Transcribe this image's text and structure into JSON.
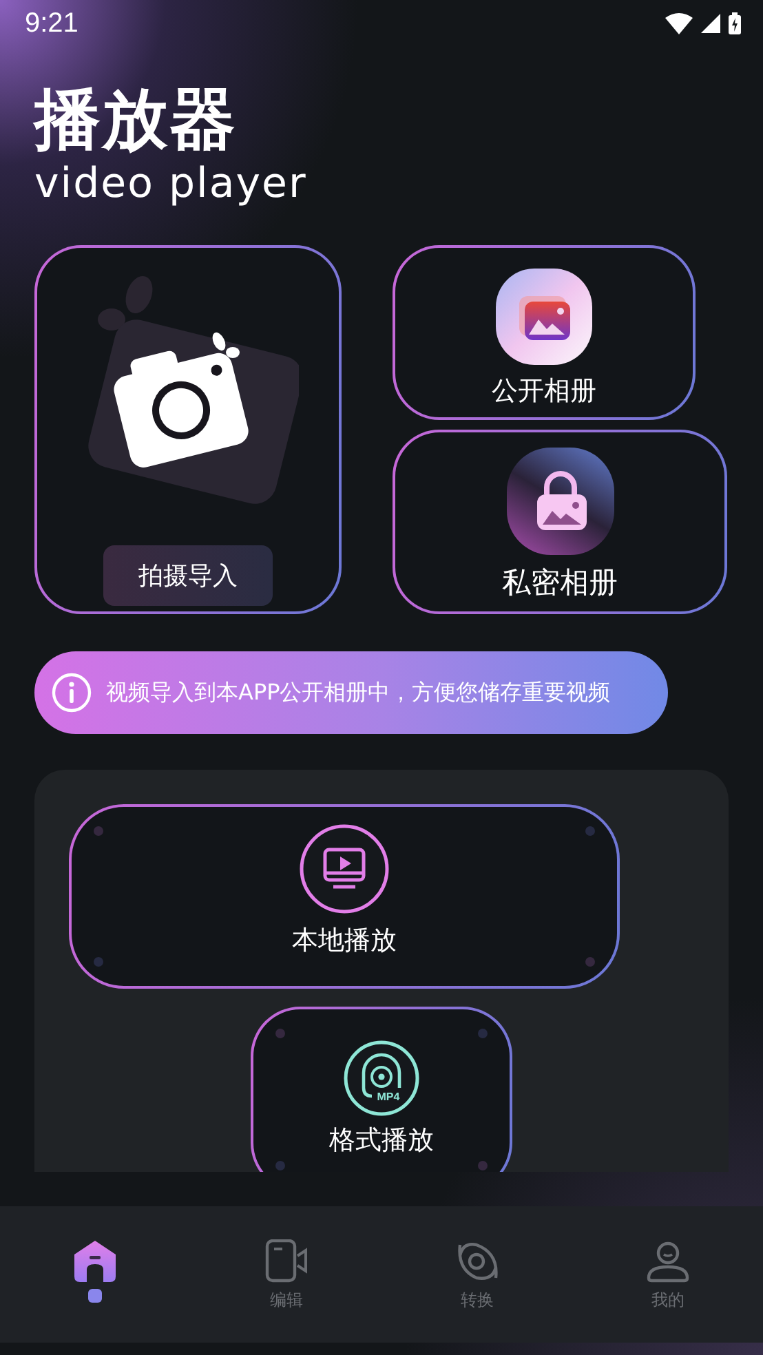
{
  "status_bar": {
    "time": "9:21"
  },
  "header": {
    "title": "播放器",
    "subtitle": "video player"
  },
  "import_card": {
    "button": "拍摄导入"
  },
  "albums": [
    {
      "label": "公开相册",
      "kind": "public"
    },
    {
      "label": "私密相册",
      "kind": "private"
    }
  ],
  "notice": {
    "text": "视频导入到本APP公开相册中，方便您储存重要视频"
  },
  "features": [
    {
      "label": "本地播放",
      "kind": "local"
    },
    {
      "label": "格式播放",
      "kind": "format",
      "icon_text": "MP4"
    }
  ],
  "nav": [
    {
      "kind": "home",
      "selected": true
    },
    {
      "kind": "edit",
      "label": "编辑",
      "selected": false
    },
    {
      "kind": "convert",
      "label": "转换",
      "selected": false
    },
    {
      "kind": "profile",
      "label": "我的",
      "selected": false
    }
  ]
}
